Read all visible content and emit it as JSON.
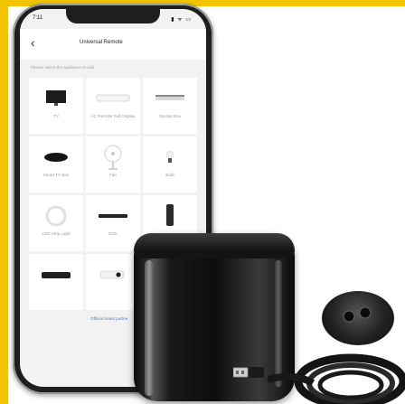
{
  "colors": {
    "frame_accent": "#f2c500",
    "phone_body": "#1e1e1e",
    "screen_bg": "#f2f2f3",
    "link_blue": "#5b78c8",
    "hub_black": "#0c0c0c"
  },
  "statusbar": {
    "time": "7:11",
    "icons": "▮ ᯤ ▭"
  },
  "app": {
    "back_icon": "‹",
    "title": "Universal Remote",
    "hint": "Please select the appliance to add",
    "appliances": [
      {
        "label": "TV",
        "icon": "tv-icon"
      },
      {
        "label": "AC Remote Full Display",
        "icon": "ac-icon"
      },
      {
        "label": "Set-top Box",
        "icon": "settop-box-icon"
      },
      {
        "label": "Smart TV Box",
        "icon": "smart-tv-box-icon"
      },
      {
        "label": "Fan",
        "icon": "fan-icon"
      },
      {
        "label": "Bulb",
        "icon": "bulb-icon"
      },
      {
        "label": "LED Strip Light",
        "icon": "led-strip-icon"
      },
      {
        "label": "DVD",
        "icon": "dvd-icon"
      },
      {
        "label": "",
        "icon": "remote-icon"
      },
      {
        "label": "",
        "icon": "soundbar-icon"
      },
      {
        "label": "",
        "icon": "projector-icon"
      },
      {
        "label": "",
        "icon": "blank"
      }
    ],
    "brand_note": "Official brand partne"
  }
}
